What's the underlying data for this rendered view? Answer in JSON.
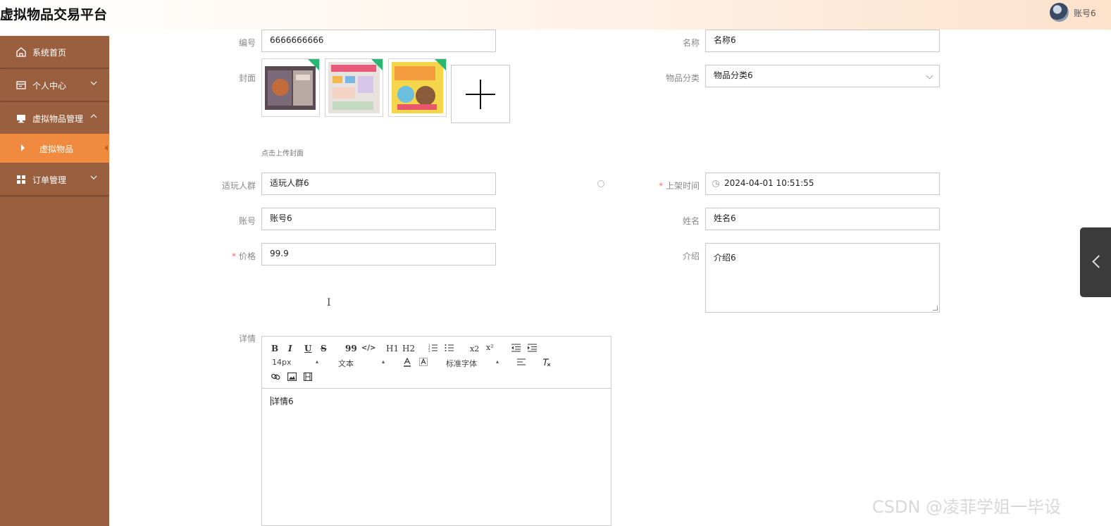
{
  "header": {
    "app_title": "虚拟物品交易平台",
    "user_name": "账号6"
  },
  "sidebar": {
    "items": [
      {
        "label": "系统首页",
        "icon": "home-icon"
      },
      {
        "label": "个人中心",
        "icon": "profile-icon"
      },
      {
        "label": "虚拟物品管理",
        "icon": "monitor-icon"
      },
      {
        "label": "订单管理",
        "icon": "grid-icon"
      }
    ],
    "sub_item": {
      "label": "虚拟物品"
    }
  },
  "form": {
    "id_label": "编号",
    "id_value": "6666666666",
    "name_label": "名称",
    "name_value": "名称6",
    "cover_label": "封面",
    "upload_hint": "点击上传封面",
    "category_label": "物品分类",
    "category_value": "物品分类6",
    "audience_label": "适玩人群",
    "audience_value": "适玩人群6",
    "listed_time_label": "上架时间",
    "listed_time_value": "2024-04-01 10:51:55",
    "account_label": "账号",
    "account_value": "账号6",
    "realname_label": "姓名",
    "realname_value": "姓名6",
    "price_label": "价格",
    "price_value": "99.9",
    "intro_label": "介绍",
    "intro_value": "介绍6",
    "detail_label": "详情",
    "required_mark": "*"
  },
  "editor": {
    "buttons": [
      "B",
      "I",
      "U",
      "S",
      "99",
      "</>",
      "H1",
      "H2",
      "ol",
      "ul",
      "x2",
      "x²",
      "outdent",
      "indent"
    ],
    "font_size": "14px",
    "block_format": "文本",
    "font_family": "标准字体",
    "content": "详情6"
  },
  "colors": {
    "sidebar": "#9a5f3f",
    "active_item": "#f08a3e",
    "required": "#f56c6c"
  },
  "watermark": "CSDN @凌菲学姐一毕设"
}
